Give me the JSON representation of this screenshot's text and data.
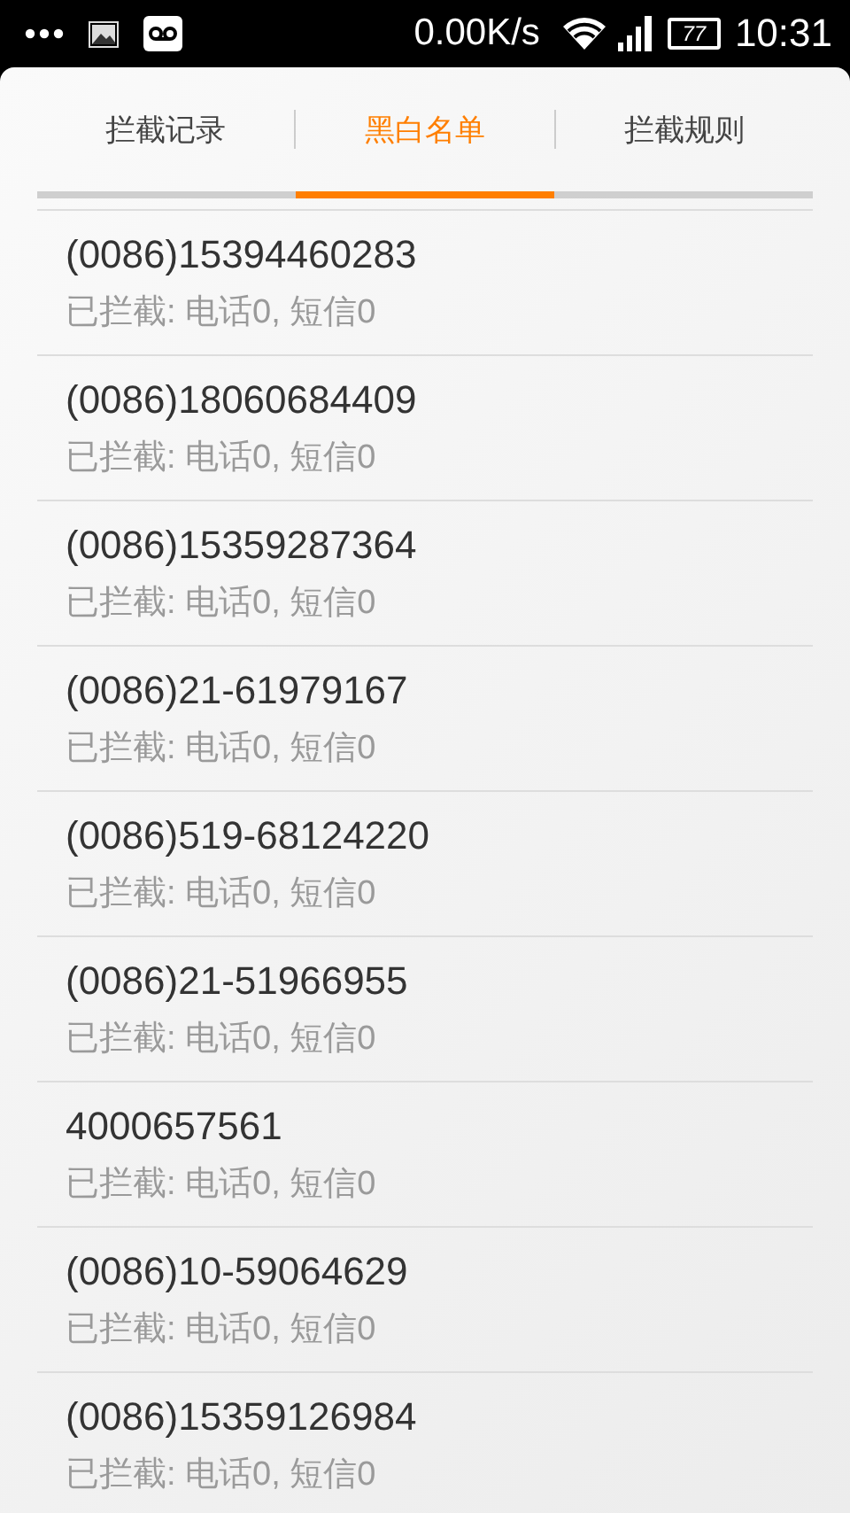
{
  "status_bar": {
    "speed": "0.00K/s",
    "battery": "77",
    "time": "10:31"
  },
  "tabs": [
    {
      "label": "拦截记录",
      "selected": false
    },
    {
      "label": "黑白名单",
      "selected": true
    },
    {
      "label": "拦截规则",
      "selected": false
    }
  ],
  "entries": [
    {
      "number": "(0086)15394460283",
      "detail": "已拦截: 电话0, 短信0"
    },
    {
      "number": "(0086)18060684409",
      "detail": "已拦截: 电话0, 短信0"
    },
    {
      "number": "(0086)15359287364",
      "detail": "已拦截: 电话0, 短信0"
    },
    {
      "number": "(0086)21-61979167",
      "detail": "已拦截: 电话0, 短信0"
    },
    {
      "number": "(0086)519-68124220",
      "detail": "已拦截: 电话0, 短信0"
    },
    {
      "number": "(0086)21-51966955",
      "detail": "已拦截: 电话0, 短信0"
    },
    {
      "number": "4000657561",
      "detail": "已拦截: 电话0, 短信0"
    },
    {
      "number": "(0086)10-59064629",
      "detail": "已拦截: 电话0, 短信0"
    },
    {
      "number": "(0086)15359126984",
      "detail": "已拦截: 电话0, 短信0"
    }
  ]
}
